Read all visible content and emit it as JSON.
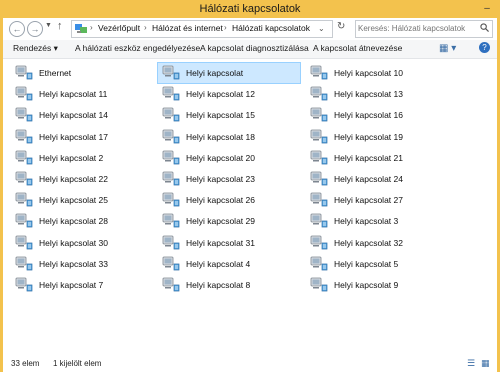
{
  "window": {
    "title": "Hálózati kapcsolatok"
  },
  "address": {
    "breadcrumb": [
      "Vezérlőpult",
      "Hálózat és internet",
      "Hálózati kapcsolatok"
    ],
    "search_placeholder": "Keresés: Hálózati kapcsolatok"
  },
  "commands": [
    "Rendezés",
    "A hálózati eszköz engedélyezése",
    "A kapcsolat diagnosztizálása",
    "A kapcsolat átnevezése"
  ],
  "items": [
    "Ethernet",
    "Helyi kapcsolat",
    "Helyi kapcsolat 10",
    "Helyi kapcsolat 11",
    "Helyi kapcsolat 12",
    "Helyi kapcsolat 13",
    "Helyi kapcsolat 14",
    "Helyi kapcsolat 15",
    "Helyi kapcsolat 16",
    "Helyi kapcsolat 17",
    "Helyi kapcsolat 18",
    "Helyi kapcsolat 19",
    "Helyi kapcsolat 2",
    "Helyi kapcsolat 20",
    "Helyi kapcsolat 21",
    "Helyi kapcsolat 22",
    "Helyi kapcsolat 23",
    "Helyi kapcsolat 24",
    "Helyi kapcsolat 25",
    "Helyi kapcsolat 26",
    "Helyi kapcsolat 27",
    "Helyi kapcsolat 28",
    "Helyi kapcsolat 29",
    "Helyi kapcsolat 3",
    "Helyi kapcsolat 30",
    "Helyi kapcsolat 31",
    "Helyi kapcsolat 32",
    "Helyi kapcsolat 33",
    "Helyi kapcsolat 4",
    "Helyi kapcsolat 5",
    "Helyi kapcsolat 7",
    "Helyi kapcsolat 8",
    "Helyi kapcsolat 9"
  ],
  "selected_item": "Helyi kapcsolat",
  "status": {
    "count": "33 elem",
    "selected": "1 kijelölt elem"
  },
  "colors": {
    "titlebar": "#f3c24d",
    "selection": "#cde8ff"
  }
}
